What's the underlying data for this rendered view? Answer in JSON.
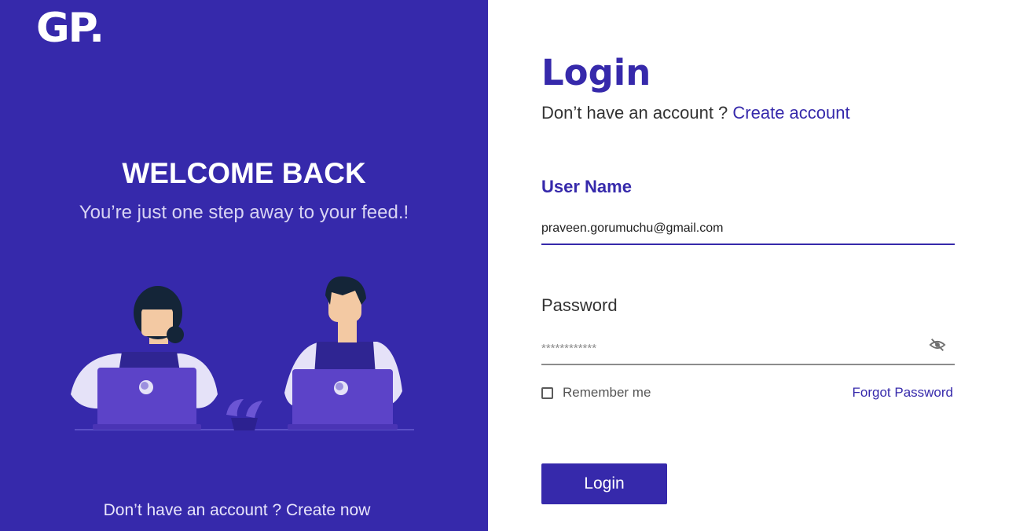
{
  "brand": {
    "logo_text": "GP."
  },
  "left_panel": {
    "heading": "WELCOME BACK",
    "subheading": "You’re just one step away to your feed.!",
    "bottom_prefix": "Don’t have an account ? ",
    "bottom_link": "Create now",
    "illustration": "two-people-working-on-laptops"
  },
  "login_form": {
    "title": "Login",
    "no_account_prefix": "Don’t have an account ? ",
    "create_account_link": "Create account",
    "username_label": "User Name",
    "username_value": "praveen.gorumuchu@gmail.com",
    "password_label": "Password",
    "password_value": "************",
    "password_toggle_icon": "eye-slash-icon",
    "remember_label": "Remember me",
    "remember_checked": false,
    "forgot_link": "Forgot Password",
    "submit_label": "Login"
  },
  "colors": {
    "primary": "#3629ab",
    "laptop": "#5c43c8",
    "text_dark": "#333333",
    "text_muted": "#8c8c8c"
  }
}
